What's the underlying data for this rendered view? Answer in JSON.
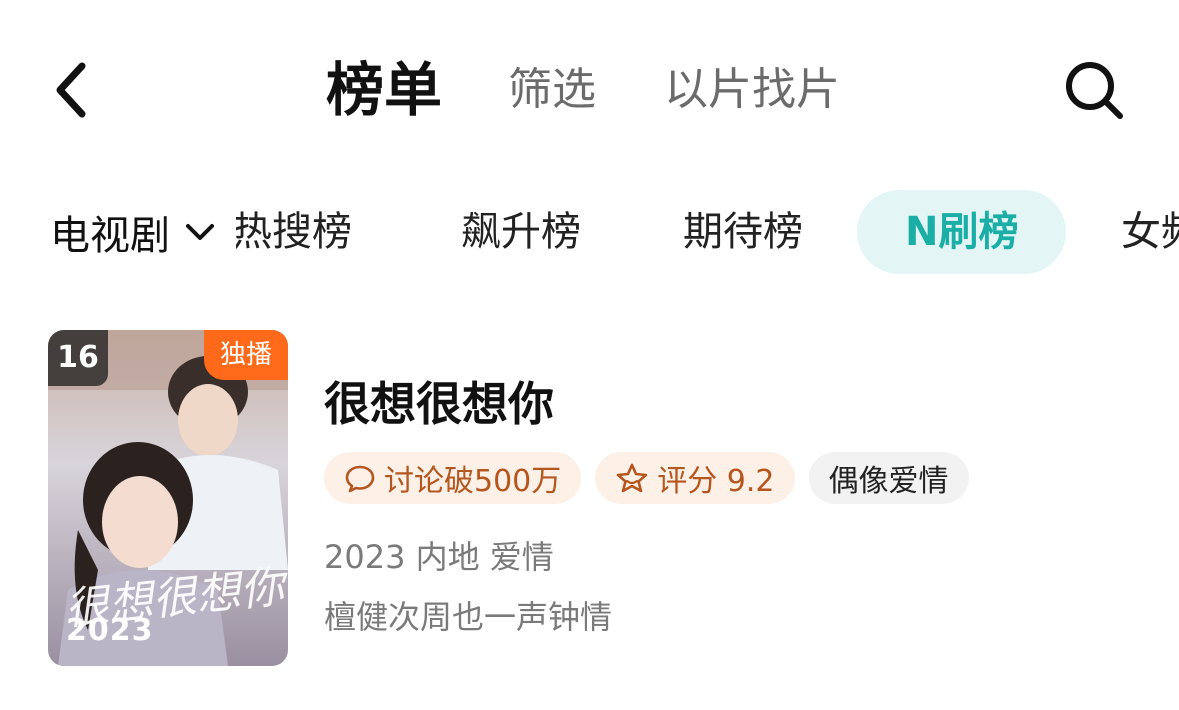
{
  "header": {
    "tabs": [
      {
        "label": "榜单",
        "active": true
      },
      {
        "label": "筛选",
        "active": false
      },
      {
        "label": "以片找片",
        "active": false
      }
    ],
    "back_icon": "chevron-left-icon",
    "search_icon": "search-icon"
  },
  "filter": {
    "category": "电视剧",
    "category_icon": "chevron-down-icon",
    "rank_tabs": [
      {
        "label": "热搜榜",
        "active": false
      },
      {
        "label": "飙升榜",
        "active": false
      },
      {
        "label": "期待榜",
        "active": false
      },
      {
        "label": "N刷榜",
        "active": true
      },
      {
        "label": "女频",
        "active": false
      }
    ],
    "active_color": "#1aaea7"
  },
  "items": [
    {
      "rank": "16",
      "badge": "独播",
      "poster_year": "2023",
      "poster_title": "很想很想你",
      "title": "很想很想你",
      "tags": {
        "discuss": "讨论破500万",
        "rating": "评分 9.2",
        "genre": "偶像爱情"
      },
      "meta": "2023 内地 爱情",
      "desc": "檀健次周也一声钟情"
    }
  ],
  "colors": {
    "badge_orange": "#ff6a1a",
    "tag_orange_text": "#b5561f"
  }
}
